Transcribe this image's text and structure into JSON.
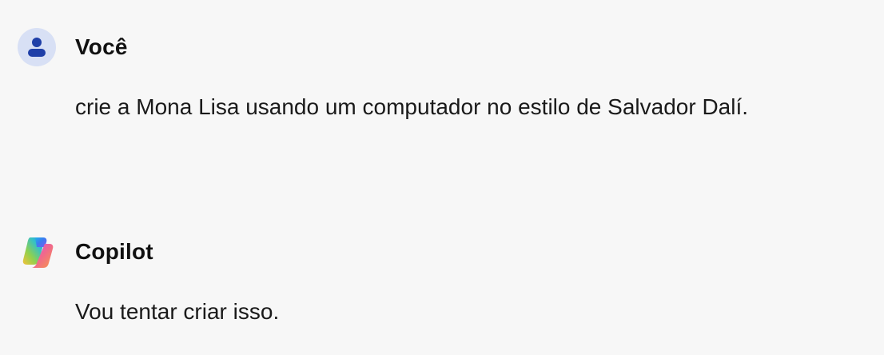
{
  "conversation": {
    "messages": [
      {
        "role": "user",
        "author": "Você",
        "avatar_icon": "user-icon",
        "text": "crie a Mona Lisa usando um computador no estilo de Salvador Dalí."
      },
      {
        "role": "assistant",
        "author": "Copilot",
        "avatar_icon": "copilot-logo-icon",
        "text": "Vou tentar criar isso."
      }
    ]
  },
  "colors": {
    "background": "#f7f7f7",
    "user_avatar_bg": "#d8e0f5",
    "user_avatar_glyph": "#1f3fa8",
    "text": "#1a1a1a"
  }
}
